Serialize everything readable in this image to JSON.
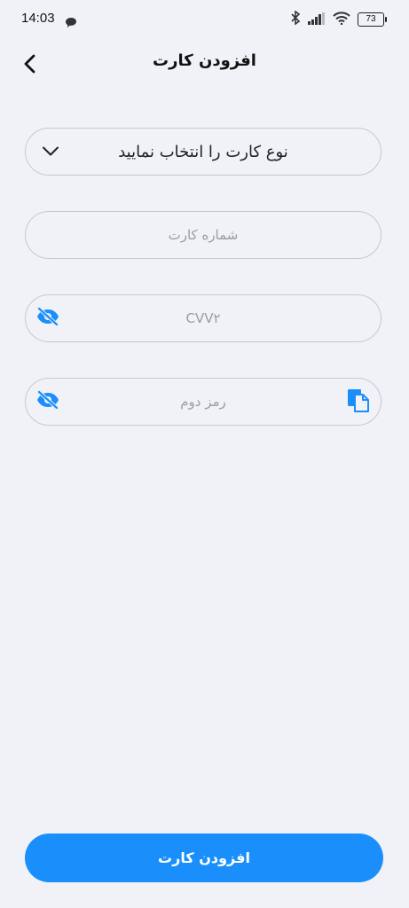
{
  "status_bar": {
    "time": "14:03",
    "battery": "73"
  },
  "header": {
    "title": "افزودن کارت",
    "back_icon": "chevron-left-icon"
  },
  "form": {
    "card_type": {
      "label": "نوع کارت را انتخاب نمایید",
      "icon": "chevron-down-icon"
    },
    "card_number": {
      "placeholder": "شماره کارت"
    },
    "cvv2": {
      "placeholder": "CVV۲",
      "icon": "eye-off-icon"
    },
    "second_password": {
      "placeholder": "رمز دوم",
      "icons": [
        "eye-off-icon",
        "paste-icon"
      ]
    }
  },
  "submit": {
    "label": "افزودن کارت"
  },
  "colors": {
    "accent": "#1a8ffb",
    "background": "#f1f2f7",
    "border": "#c7c9cf"
  }
}
